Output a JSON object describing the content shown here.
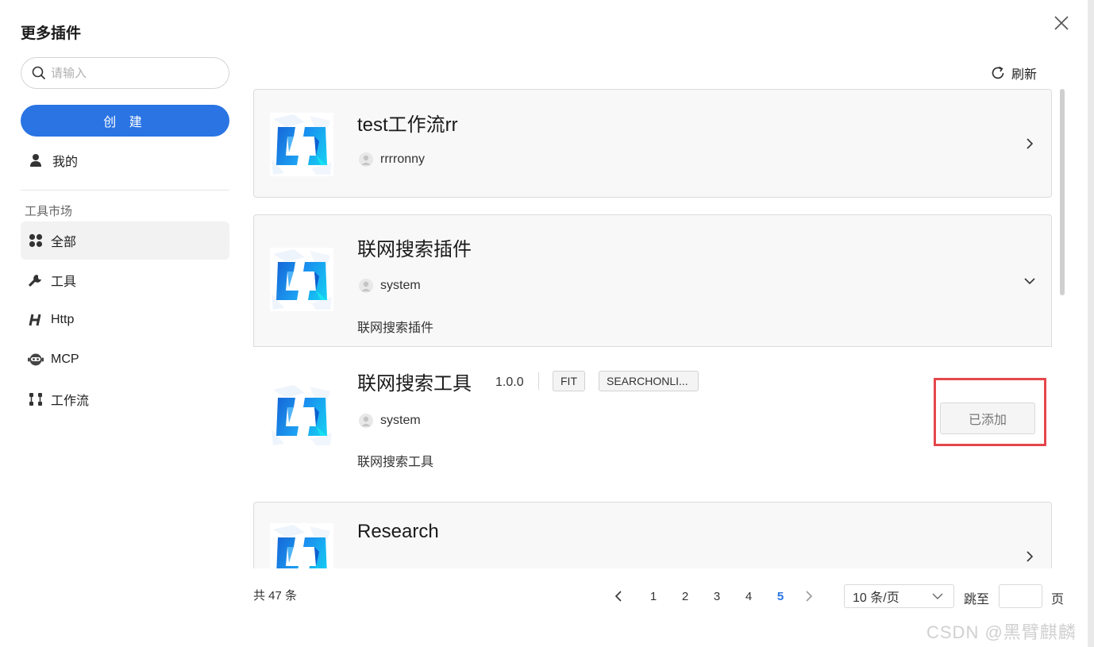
{
  "modal": {
    "title": "更多插件"
  },
  "sidebar": {
    "search_placeholder": "请输入",
    "create_label": "创 建",
    "mine_label": "我的",
    "section_label": "工具市场",
    "items": [
      {
        "label": "全部",
        "icon": "grid-icon",
        "active": true
      },
      {
        "label": "工具",
        "icon": "wrench-icon"
      },
      {
        "label": "Http",
        "icon": "http-icon"
      },
      {
        "label": "MCP",
        "icon": "robot-icon"
      },
      {
        "label": "工作流",
        "icon": "workflow-icon"
      }
    ]
  },
  "toolbar": {
    "refresh_label": "刷新"
  },
  "cards": [
    {
      "name": "test工作流rr",
      "author": "rrrronny"
    },
    {
      "name": "联网搜索插件",
      "author": "system",
      "description": "联网搜索插件",
      "sub_item": {
        "name": "联网搜索工具",
        "version": "1.0.0",
        "tags": [
          "FIT",
          "SEARCHONLI..."
        ],
        "author": "system",
        "description": "联网搜索工具",
        "status_label": "已添加"
      }
    },
    {
      "name": "Research"
    }
  ],
  "pagination": {
    "total_text": "共 47 条",
    "pages": [
      "1",
      "2",
      "3",
      "4",
      "5"
    ],
    "current": "5",
    "page_size": "10 条/页",
    "jump_label": "跳至",
    "jump_unit": "页"
  },
  "watermark": "CSDN @黑臂麒麟",
  "colors": {
    "primary": "#2a74e3",
    "highlight_border": "#e5474b",
    "logo_blue": "#1f8ef1",
    "logo_cyan": "#15c8f0"
  }
}
